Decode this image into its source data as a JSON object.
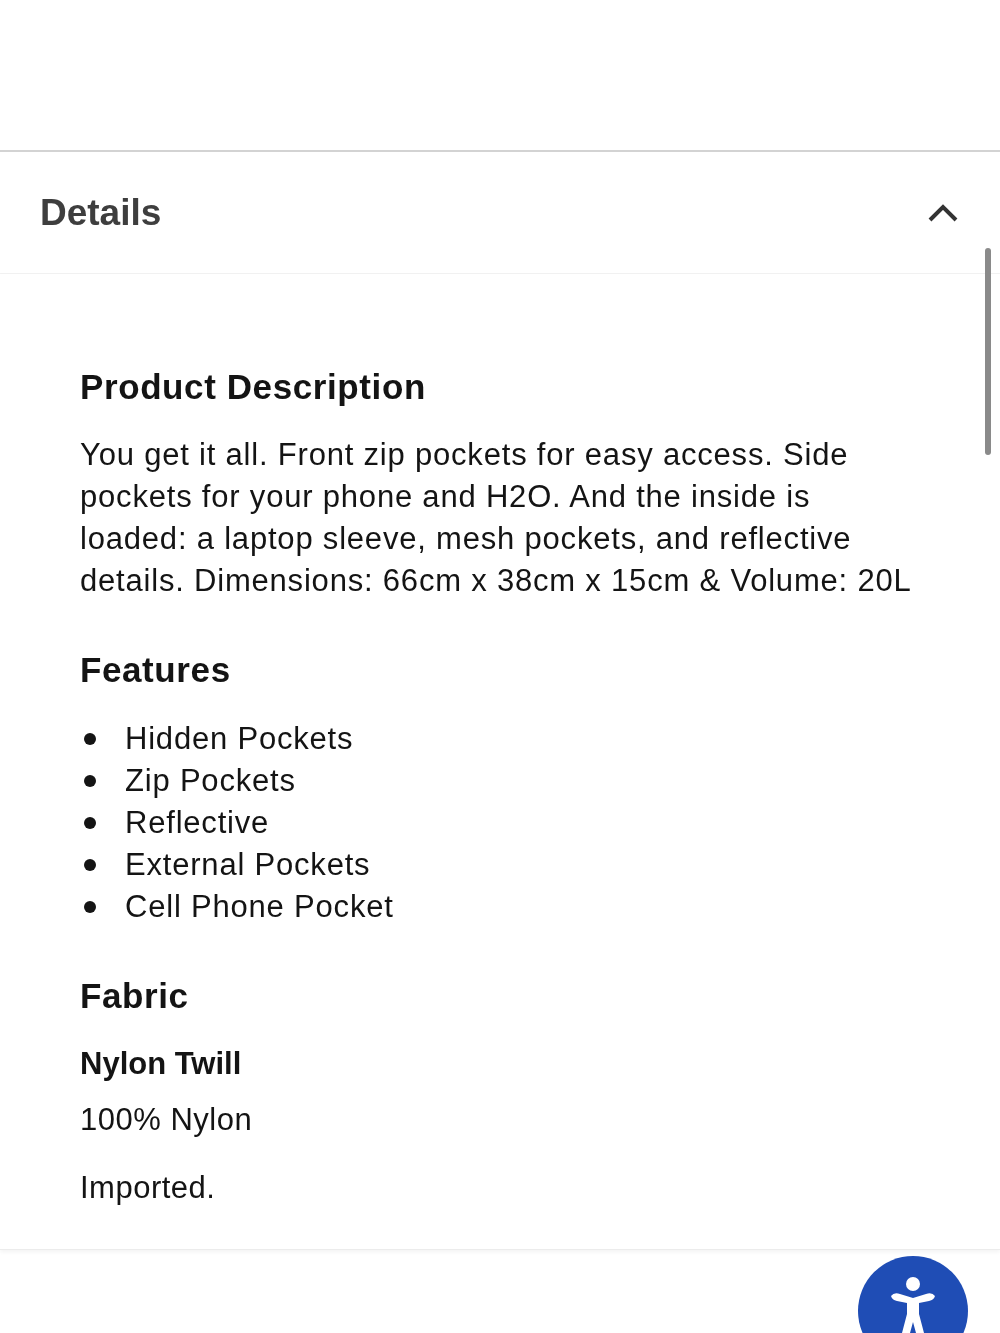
{
  "details": {
    "title": "Details",
    "expanded": true,
    "sections": [
      {
        "kind": "paragraph",
        "heading": "Product Description",
        "text": "You get it all. Front zip pockets for easy access. Side pockets for your phone and H2O. And the inside is loaded: a laptop sleeve, mesh pockets, and reflective details. Dimensions: 66cm x 38cm x 15cm & Volume: 20L"
      },
      {
        "kind": "list",
        "heading": "Features",
        "items": [
          "Hidden Pockets",
          "Zip Pockets",
          "Reflective",
          "External Pockets",
          "Cell Phone Pocket"
        ]
      },
      {
        "kind": "fabric",
        "heading": "Fabric",
        "name": "Nylon Twill",
        "composition": "100% Nylon",
        "note": "Imported."
      }
    ]
  }
}
